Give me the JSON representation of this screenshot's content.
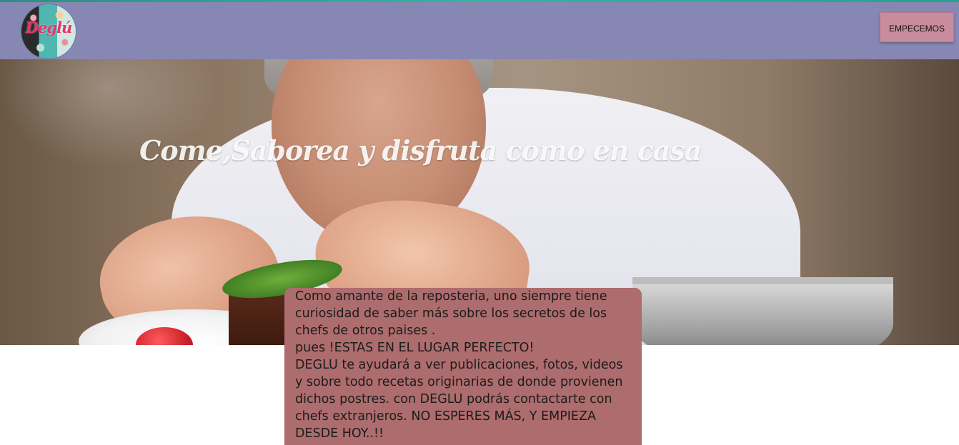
{
  "navbar": {
    "logo_text": "Deglú",
    "start_button_label": "EMPECEMOS"
  },
  "hero": {
    "title": "Come,Saborea y disfruta como en casa"
  },
  "intro": {
    "lines": [
      "Como amante de la reposteria, uno siempre tiene",
      "curiosidad de saber más sobre los secretos de los",
      "chefs de otros paises .",
      "pues !ESTAS EN EL LUGAR PERFECTO!",
      "DEGLU te ayudará a ver publicaciones, fotos, videos",
      "y sobre todo recetas originarias de donde provienen",
      "dichos postres. con DEGLU podrás contactarte con",
      "chefs extranjeros. NO ESPERES MÁS, Y EMPIEZA",
      "DESDE HOY..!!"
    ]
  },
  "colors": {
    "navbar_bg": "#8787b4",
    "button_bg": "#c98b9e",
    "intro_bg": "#ad6c6d",
    "top_line": "#39b39b"
  }
}
